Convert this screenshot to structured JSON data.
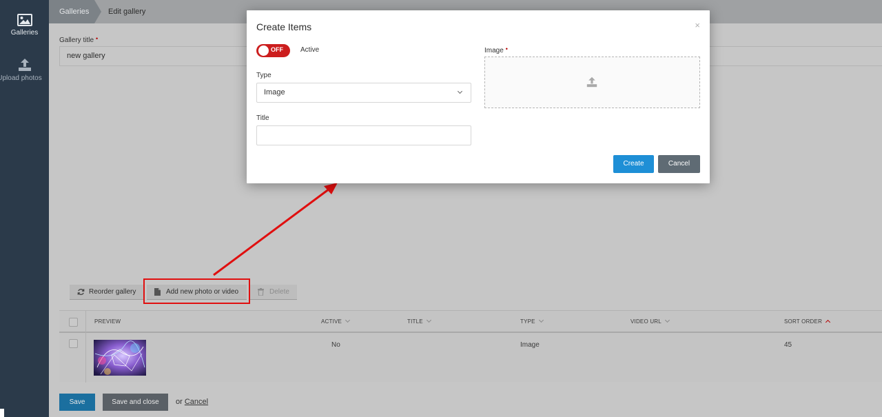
{
  "sidebar": {
    "items": [
      {
        "label": "Galleries",
        "icon": "image-icon"
      },
      {
        "label": "Upload photos",
        "icon": "upload-icon"
      }
    ]
  },
  "breadcrumb": {
    "items": [
      "Galleries",
      "Edit gallery"
    ]
  },
  "gallery_form": {
    "title_label": "Gallery title",
    "title_value": "new gallery",
    "required_mark": "•"
  },
  "toolbar": {
    "reorder_label": "Reorder gallery",
    "add_label": "Add new photo or video",
    "delete_label": "Delete"
  },
  "table": {
    "columns": [
      "PREVIEW",
      "ACTIVE",
      "TITLE",
      "TYPE",
      "VIDEO URL",
      "SORT ORDER"
    ],
    "rows": [
      {
        "active": "No",
        "title": "",
        "type": "Image",
        "video_url": "",
        "sort_order": "45"
      }
    ]
  },
  "footer": {
    "save_label": "Save",
    "save_close_label": "Save and close",
    "or_text": "or",
    "cancel_label": "Cancel"
  },
  "modal": {
    "title": "Create Items",
    "close_glyph": "×",
    "toggle_text": "OFF",
    "active_label": "Active",
    "type_label": "Type",
    "type_value": "Image",
    "title_label": "Title",
    "title_value": "",
    "image_label": "Image",
    "required_mark": "•",
    "create_label": "Create",
    "cancel_label": "Cancel"
  },
  "colors": {
    "sidebar_bg": "#2b3a4a",
    "toggle_off": "#cc1e1e",
    "create_button": "#1e8fd6",
    "cancel_button": "#5f6b74",
    "highlight": "#e00f0f"
  }
}
